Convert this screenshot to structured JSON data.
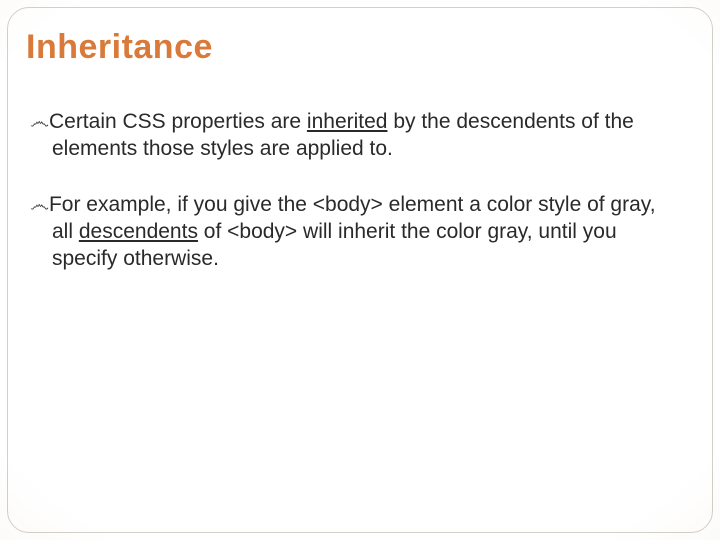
{
  "slide": {
    "title": "Inheritance",
    "bullet_glyph": "෴",
    "p1": {
      "a": "Certain CSS properties are ",
      "u": "inherited",
      "b": " by the descendents of the elements those styles are applied to."
    },
    "p2": {
      "a": "For example, if you give the <body> element a color style of gray, all ",
      "u": "descendents",
      "b": " of <body> will inherit the color gray, until you specify otherwise."
    }
  }
}
